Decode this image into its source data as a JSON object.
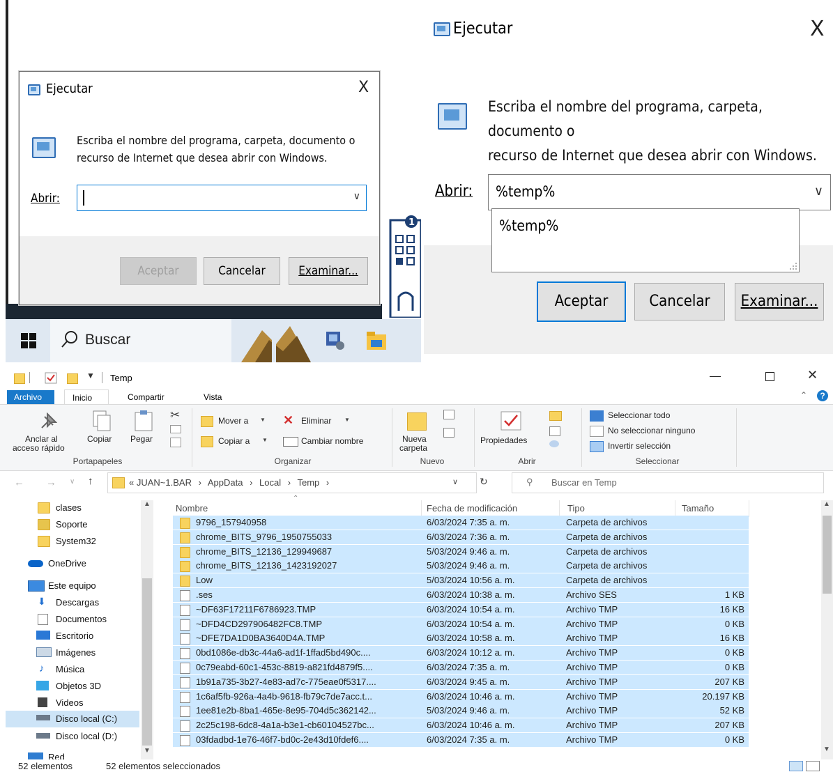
{
  "run_dialog": {
    "title": "Ejecutar",
    "close": "X",
    "description_line1": "Escriba el nombre del programa, carpeta, documento o",
    "description_line2": "recurso de Internet que desea abrir con Windows.",
    "open_label": "Abrir:",
    "accept": "Aceptar",
    "cancel": "Cancelar",
    "browse": "Examinar..."
  },
  "run_dialog_zoomed": {
    "title": "Ejecutar",
    "close": "X",
    "description_line1": "Escriba el nombre del programa, carpeta, documento o",
    "description_line2": "recurso de Internet que desea abrir con Windows.",
    "open_label": "Abrir:",
    "open_value": "%temp%",
    "suggestion": "%temp%",
    "accept": "Aceptar",
    "cancel": "Cancelar",
    "browse": "Examinar..."
  },
  "taskbar": {
    "search_label": "Buscar"
  },
  "explorer": {
    "window_title": "Temp",
    "tabs": [
      "Archivo",
      "Inicio",
      "Compartir",
      "Vista"
    ],
    "ribbon": {
      "pin_line1": "Anclar al",
      "pin_line2": "acceso rápido",
      "copy": "Copiar",
      "paste": "Pegar",
      "group_clipboard": "Portapapeles",
      "move_to": "Mover a",
      "copy_to": "Copiar a",
      "delete": "Eliminar",
      "rename": "Cambiar nombre",
      "group_organize": "Organizar",
      "new_folder_line1": "Nueva",
      "new_folder_line2": "carpeta",
      "group_new": "Nuevo",
      "properties": "Propiedades",
      "group_open": "Abrir",
      "select_all": "Seleccionar todo",
      "select_none": "No seleccionar ninguno",
      "invert_selection": "Invertir selección",
      "group_select": "Seleccionar"
    },
    "address": {
      "prefix": "«",
      "segments": [
        "JUAN~1.BAR",
        "AppData",
        "Local",
        "Temp"
      ],
      "search_placeholder": "Buscar en Temp"
    },
    "nav": [
      {
        "label": "clases",
        "icon": "folder-icon"
      },
      {
        "label": "Soporte",
        "icon": "folder-user-icon"
      },
      {
        "label": "System32",
        "icon": "folder-icon"
      },
      {
        "label": "OneDrive",
        "icon": "cloud-icon"
      },
      {
        "label": "Este equipo",
        "icon": "computer-icon"
      },
      {
        "label": "Descargas",
        "icon": "download-icon"
      },
      {
        "label": "Documentos",
        "icon": "document-icon"
      },
      {
        "label": "Escritorio",
        "icon": "desktop-icon"
      },
      {
        "label": "Imágenes",
        "icon": "image-icon"
      },
      {
        "label": "Música",
        "icon": "music-icon"
      },
      {
        "label": "Objetos 3D",
        "icon": "cube-icon"
      },
      {
        "label": "Videos",
        "icon": "video-icon"
      },
      {
        "label": "Disco local (C:)",
        "icon": "drive-icon"
      },
      {
        "label": "Disco local (D:)",
        "icon": "drive-icon"
      },
      {
        "label": "Red",
        "icon": "network-icon"
      }
    ],
    "columns": [
      "Nombre",
      "Fecha de modificación",
      "Tipo",
      "Tamaño"
    ],
    "files": [
      {
        "name": "9796_157940958",
        "date": "6/03/2024 7:35 a. m.",
        "type": "Carpeta de archivos",
        "size": "",
        "folder": true
      },
      {
        "name": "chrome_BITS_9796_1950755033",
        "date": "6/03/2024 7:36 a. m.",
        "type": "Carpeta de archivos",
        "size": "",
        "folder": true
      },
      {
        "name": "chrome_BITS_12136_129949687",
        "date": "5/03/2024 9:46 a. m.",
        "type": "Carpeta de archivos",
        "size": "",
        "folder": true
      },
      {
        "name": "chrome_BITS_12136_1423192027",
        "date": "5/03/2024 9:46 a. m.",
        "type": "Carpeta de archivos",
        "size": "",
        "folder": true
      },
      {
        "name": "Low",
        "date": "5/03/2024 10:56 a. m.",
        "type": "Carpeta de archivos",
        "size": "",
        "folder": true
      },
      {
        "name": ".ses",
        "date": "6/03/2024 10:38 a. m.",
        "type": "Archivo SES",
        "size": "1 KB",
        "folder": false
      },
      {
        "name": "~DF63F17211F6786923.TMP",
        "date": "6/03/2024 10:54 a. m.",
        "type": "Archivo TMP",
        "size": "16 KB",
        "folder": false
      },
      {
        "name": "~DFD4CD297906482FC8.TMP",
        "date": "6/03/2024 10:54 a. m.",
        "type": "Archivo TMP",
        "size": "0 KB",
        "folder": false
      },
      {
        "name": "~DFE7DA1D0BA3640D4A.TMP",
        "date": "6/03/2024 10:58 a. m.",
        "type": "Archivo TMP",
        "size": "16 KB",
        "folder": false
      },
      {
        "name": "0bd1086e-db3c-44a6-ad1f-1ffad5bd490c....",
        "date": "6/03/2024 10:12 a. m.",
        "type": "Archivo TMP",
        "size": "0 KB",
        "folder": false
      },
      {
        "name": "0c79eabd-60c1-453c-8819-a821fd4879f5....",
        "date": "6/03/2024 7:35 a. m.",
        "type": "Archivo TMP",
        "size": "0 KB",
        "folder": false
      },
      {
        "name": "1b91a735-3b27-4e83-ad7c-775eae0f5317....",
        "date": "6/03/2024 9:45 a. m.",
        "type": "Archivo TMP",
        "size": "207 KB",
        "folder": false
      },
      {
        "name": "1c6af5fb-926a-4a4b-9618-fb79c7de7acc.t...",
        "date": "6/03/2024 10:46 a. m.",
        "type": "Archivo TMP",
        "size": "20.197 KB",
        "folder": false
      },
      {
        "name": "1ee81e2b-8ba1-465e-8e95-704d5c362142...",
        "date": "5/03/2024 9:46 a. m.",
        "type": "Archivo TMP",
        "size": "52 KB",
        "folder": false
      },
      {
        "name": "2c25c198-6dc8-4a1a-b3e1-cb60104527bc...",
        "date": "6/03/2024 10:46 a. m.",
        "type": "Archivo TMP",
        "size": "207 KB",
        "folder": false
      },
      {
        "name": "03fdadbd-1e76-46f7-bd0c-2e43d10fdef6....",
        "date": "6/03/2024 7:35 a. m.",
        "type": "Archivo TMP",
        "size": "0 KB",
        "folder": false
      }
    ],
    "status_count": "52 elementos",
    "status_selected": "52 elementos seleccionados"
  },
  "colors": {
    "selection": "#cce8ff",
    "accent": "#0078d7",
    "folder": "#f8d35e"
  }
}
